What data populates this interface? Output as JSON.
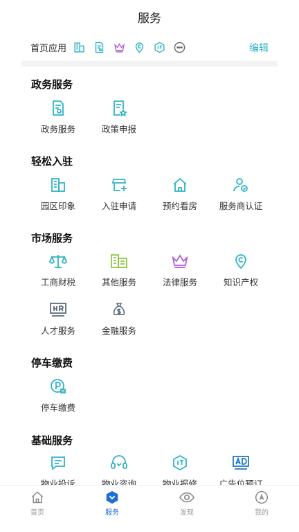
{
  "header": {
    "title": "服务"
  },
  "home_apps": {
    "label": "首页应用",
    "icons": [
      "building-icon",
      "document-icon",
      "crown-icon",
      "copyright-pin-icon",
      "it-badge-icon",
      "more-icon"
    ],
    "edit_label": "编辑"
  },
  "colors": {
    "accent": "#2fb3c6",
    "active_tab": "#1e6fd0",
    "green": "#8cc63f",
    "purple": "#b05cd6"
  },
  "sections": [
    {
      "title": "政务服务",
      "items": [
        {
          "label": "政务服务",
          "icon": "government-doc-icon"
        },
        {
          "label": "政策申报",
          "icon": "policy-doc-icon"
        }
      ]
    },
    {
      "title": "轻松入驻",
      "items": [
        {
          "label": "园区印象",
          "icon": "building-icon"
        },
        {
          "label": "入驻申请",
          "icon": "shop-add-icon"
        },
        {
          "label": "预约看房",
          "icon": "house-icon"
        },
        {
          "label": "服务商认证",
          "icon": "user-cert-icon"
        }
      ]
    },
    {
      "title": "市场服务",
      "items": [
        {
          "label": "工商财税",
          "icon": "scale-icon"
        },
        {
          "label": "其他服务",
          "icon": "buildings-icon"
        },
        {
          "label": "法律服务",
          "icon": "crown-icon"
        },
        {
          "label": "知识产权",
          "icon": "copyright-pin-icon"
        },
        {
          "label": "人才服务",
          "icon": "hr-icon"
        },
        {
          "label": "金融服务",
          "icon": "money-bag-icon"
        }
      ]
    },
    {
      "title": "停车缴费",
      "items": [
        {
          "label": "停车缴费",
          "icon": "parking-icon"
        }
      ]
    },
    {
      "title": "基础服务",
      "items": [
        {
          "label": "物业投诉",
          "icon": "message-icon"
        },
        {
          "label": "物业咨询",
          "icon": "headset-icon"
        },
        {
          "label": "物业报修",
          "icon": "it-badge-icon"
        },
        {
          "label": "广告位预订",
          "icon": "ad-icon"
        }
      ]
    }
  ],
  "tabs": [
    {
      "label": "首页",
      "icon": "home-icon",
      "active": false
    },
    {
      "label": "服务",
      "icon": "service-icon",
      "active": true
    },
    {
      "label": "发现",
      "icon": "eye-icon",
      "active": false
    },
    {
      "label": "我的",
      "icon": "profile-icon",
      "active": false
    }
  ]
}
